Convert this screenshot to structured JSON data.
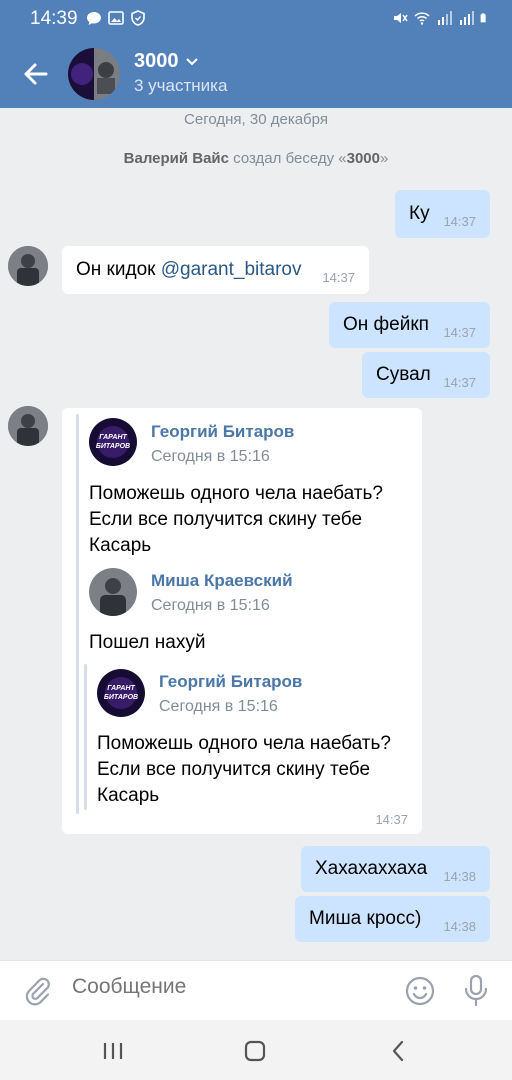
{
  "status_bar": {
    "time": "14:39"
  },
  "header": {
    "title": "3000",
    "subtitle": "3 участника"
  },
  "chat": {
    "date_separator": "Сегодня, 30 декабря",
    "system_message": {
      "actor": "Валерий Вайс",
      "action": " создал беседу «",
      "chat_name": "3000",
      "end": "»"
    },
    "messages": [
      {
        "text": "Ку",
        "time": "14:37"
      },
      {
        "text": "Он кидок ",
        "mention": "@garant_bitarov",
        "time": "14:37"
      },
      {
        "text": "Он фейкп",
        "time": "14:37"
      },
      {
        "text": "Сувал",
        "time": "14:37"
      },
      {
        "time": "14:37"
      },
      {
        "text": "Хахахаххаха",
        "time": "14:38"
      },
      {
        "text": "Миша кросс)",
        "time": "14:38"
      }
    ],
    "forwarded": [
      {
        "name": "Георгий Битаров",
        "date": "Сегодня в 15:16",
        "text": "Поможешь одного чела наебать?\nЕсли все получится скину тебе\nКасарь",
        "avatar_label": "ГАРАНТ БИТАРОВ"
      },
      {
        "name": "Миша Краевский",
        "date": "Сегодня в 15:16",
        "text": "Пошел нахуй"
      },
      {
        "name": "Георгий Битаров",
        "date": "Сегодня в 15:16",
        "text": "Поможешь одного чела наебать?\nЕсли все получится скину тебе\nКасарь",
        "avatar_label": "ГАРАНТ БИТАРОВ"
      }
    ]
  },
  "composer": {
    "placeholder": "Сообщение"
  }
}
